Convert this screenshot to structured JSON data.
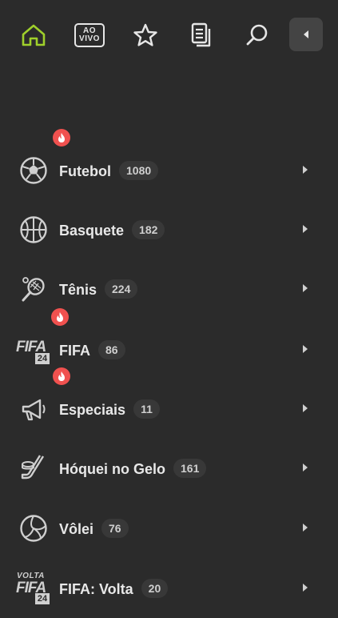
{
  "topbar": {
    "home_icon": "home-icon",
    "live_label_line1": "AO",
    "live_label_line2": "VIVO",
    "favorites_icon": "star-icon",
    "betslip_icon": "document-icon",
    "search_icon": "search-icon",
    "collapse_icon": "chevron-left-icon",
    "accent_color": "#9fd02b"
  },
  "sports": [
    {
      "label": "Futebol",
      "count": "1080",
      "icon": "soccer-ball-icon",
      "hot": true
    },
    {
      "label": "Basquete",
      "count": "182",
      "icon": "basketball-icon",
      "hot": false
    },
    {
      "label": "Tênis",
      "count": "224",
      "icon": "tennis-icon",
      "hot": false
    },
    {
      "label": "FIFA",
      "count": "86",
      "icon": "fifa-24-logo-icon",
      "hot": true,
      "logo_text": "FIFA",
      "logo_sub": "24"
    },
    {
      "label": "Especiais",
      "count": "11",
      "icon": "megaphone-icon",
      "hot": true
    },
    {
      "label": "Hóquei no Gelo",
      "count": "161",
      "icon": "hockey-icon",
      "hot": false
    },
    {
      "label": "Vôlei",
      "count": "76",
      "icon": "volleyball-icon",
      "hot": false
    },
    {
      "label": "FIFA: Volta",
      "count": "20",
      "icon": "fifa-volta-logo-icon",
      "hot": false,
      "logo_top": "VOLTA",
      "logo_text": "FIFA",
      "logo_sub": "24"
    }
  ],
  "hot_badge_color": "#f0514f"
}
